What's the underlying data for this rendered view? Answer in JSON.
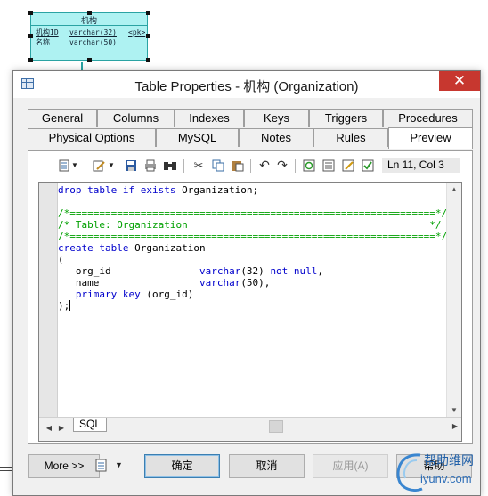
{
  "diagram": {
    "entity_name": "机构",
    "columns": [
      {
        "name": "机构ID",
        "type": "varchar(32)",
        "key": "<pk>"
      },
      {
        "name": "名称",
        "type": "varchar(50)",
        "key": ""
      }
    ]
  },
  "dialog": {
    "title": "Table Properties - 机构 (Organization)",
    "close_glyph": "✕"
  },
  "tabs": {
    "row_back": [
      "General",
      "Columns",
      "Indexes",
      "Keys",
      "Triggers",
      "Procedures"
    ],
    "row_front": [
      "Physical Options",
      "MySQL",
      "Notes",
      "Rules",
      "Preview"
    ],
    "active": "Preview"
  },
  "toolbar": {
    "icons": [
      "properties-icon",
      "dropdown-icon",
      "edit-icon",
      "dropdown-icon",
      "save-icon",
      "print-icon",
      "find-icon",
      "cut-icon",
      "copy-icon",
      "paste-icon",
      "undo-icon",
      "redo-icon",
      "refresh-icon",
      "list-icon",
      "edit-script-icon",
      "check-icon"
    ],
    "cursor_position": "Ln 11, Col 3"
  },
  "editor": {
    "lines": [
      [
        {
          "t": "drop table if exists ",
          "c": "kw"
        },
        {
          "t": "Organization;",
          "c": ""
        }
      ],
      [
        {
          "t": "",
          "c": ""
        }
      ],
      [
        {
          "t": "/*==============================================================*/",
          "c": "cm"
        }
      ],
      [
        {
          "t": "/* Table: Organization                                         */",
          "c": "cm"
        }
      ],
      [
        {
          "t": "/*==============================================================*/",
          "c": "cm"
        }
      ],
      [
        {
          "t": "create table ",
          "c": "kw"
        },
        {
          "t": "Organization",
          "c": ""
        }
      ],
      [
        {
          "t": "(",
          "c": ""
        }
      ],
      [
        {
          "t": "   org_id               ",
          "c": ""
        },
        {
          "t": "varchar",
          "c": "kw"
        },
        {
          "t": "(32) ",
          "c": ""
        },
        {
          "t": "not null",
          "c": "kw"
        },
        {
          "t": ",",
          "c": ""
        }
      ],
      [
        {
          "t": "   name                 ",
          "c": ""
        },
        {
          "t": "varchar",
          "c": "kw"
        },
        {
          "t": "(50),",
          "c": ""
        }
      ],
      [
        {
          "t": "   ",
          "c": ""
        },
        {
          "t": "primary key ",
          "c": "kw"
        },
        {
          "t": "(org_id)",
          "c": ""
        }
      ],
      [
        {
          "t": ");",
          "c": ""
        }
      ]
    ],
    "sql_tab_label": "SQL"
  },
  "footer": {
    "more_label": "More >>",
    "ok_label": "确定",
    "cancel_label": "取消",
    "apply_label": "应用(A)",
    "help_label": "帮助"
  },
  "watermark": {
    "title": "帮助维网",
    "url": "iyunv.com"
  }
}
